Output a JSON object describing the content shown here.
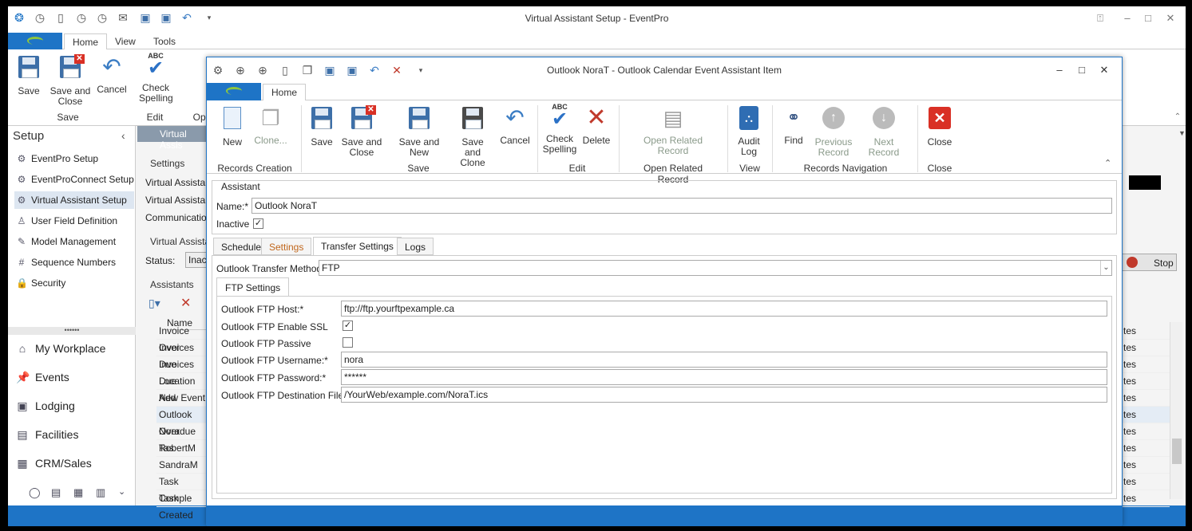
{
  "main": {
    "title": "Virtual Assistant Setup - EventPro",
    "menu": [
      "Home",
      "View",
      "Tools"
    ],
    "ribbon": {
      "save": "Save",
      "save_close": "Save and Close",
      "cancel": "Cancel",
      "check_spelling": "Check Spelling",
      "abc": "ABC",
      "groups": [
        "Save",
        "Edit",
        "Ope"
      ]
    },
    "sidebar": {
      "heading": "Setup",
      "items": [
        "EventPro Setup",
        "EventProConnect Setup",
        "Virtual Assistant Setup",
        "User Field Definition",
        "Model Management",
        "Sequence Numbers",
        "Security"
      ],
      "nav": [
        "My Workplace",
        "Events",
        "Lodging",
        "Facilities",
        "CRM/Sales"
      ],
      "splitter": "••••••"
    },
    "content": {
      "tab": "Virtual Assis",
      "settings_label": "Settings",
      "settings_rows": [
        "Virtual Assistant",
        "Virtual Assistant",
        "Communication N"
      ],
      "va_label": "Virtual Assista",
      "status_label": "Status:",
      "status_value": "Inactiv",
      "assistants_label": "Assistants",
      "grid_header": "Name",
      "grid_rows": [
        "Invoice Over",
        "Invoices Due",
        "Invoices Due",
        "Location Add",
        "New Event E",
        "Outlook Nora",
        "Overdue Tas",
        "RobertM",
        "SandraM",
        "Task Comple",
        "Task Created"
      ],
      "right_rows": [
        "tes",
        "tes",
        "tes",
        "tes",
        "tes",
        "tes",
        "tes",
        "tes",
        "tes",
        "tes",
        "tes"
      ],
      "stop_label": "Stop"
    }
  },
  "dialog": {
    "title": "Outlook NoraT - Outlook Calendar Event Assistant Item",
    "menu_tab": "Home",
    "ribbon": {
      "new": "New",
      "clone": "Clone...",
      "save": "Save",
      "save_close": "Save and Close",
      "save_new": "Save and New",
      "save_clone": "Save and Clone",
      "cancel": "Cancel",
      "check_spelling": "Check Spelling",
      "abc": "ABC",
      "delete": "Delete",
      "open_related": "Open Related Record",
      "audit_log": "Audit Log",
      "find": "Find",
      "prev_record": "Previous Record",
      "next_record": "Next Record",
      "close": "Close",
      "groups": [
        "Records Creation",
        "Save",
        "Edit",
        "Open Related Record",
        "View",
        "Records Navigation",
        "Close"
      ]
    },
    "assistant": {
      "section": "Assistant",
      "name_label": "Name:*",
      "name_value": "Outlook NoraT",
      "inactive_label": "Inactive",
      "inactive_checked": "✓"
    },
    "tabs": [
      "Schedule",
      "Settings",
      "Transfer Settings",
      "Logs"
    ],
    "transfer": {
      "method_label": "Outlook Transfer Method:",
      "method_value": "FTP",
      "ftp_tab": "FTP Settings",
      "host_label": "Outlook FTP Host:*",
      "host_value": "ftp://ftp.yourftpexample.ca",
      "ssl_label": "Outlook FTP Enable SSL",
      "ssl_checked": "✓",
      "passive_label": "Outlook FTP Passive",
      "username_label": "Outlook FTP Username:*",
      "username_value": "nora",
      "password_label": "Outlook FTP Password:*",
      "password_value": "******",
      "dest_label": "Outlook FTP Destination File:*",
      "dest_value": "/YourWeb/example.com/NoraT.ics"
    }
  }
}
